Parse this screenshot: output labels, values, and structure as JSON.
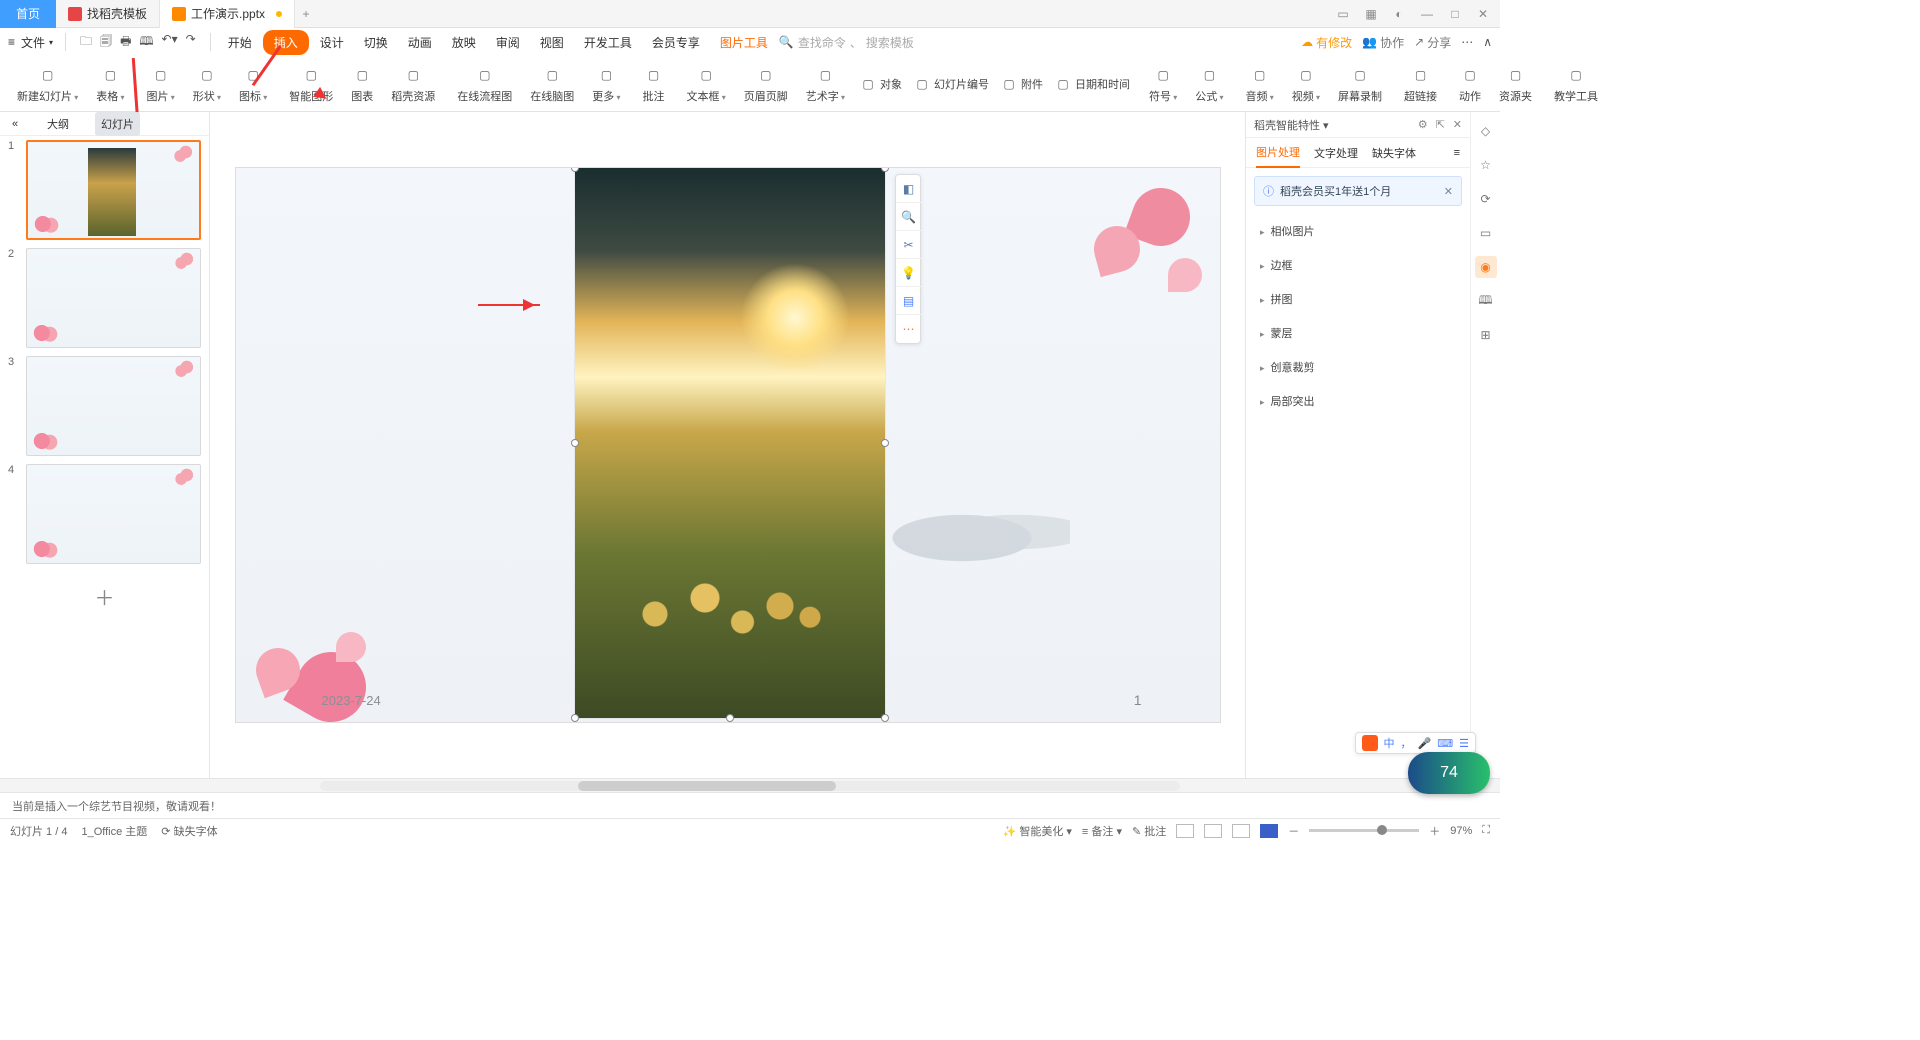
{
  "titlebar": {
    "home": "首页",
    "tab1": "找稻壳模板",
    "tab2": "工作演示.pptx",
    "plus": "+"
  },
  "menubar": {
    "file": "文件",
    "tabs": [
      "开始",
      "插入",
      "设计",
      "切换",
      "动画",
      "放映",
      "审阅",
      "视图",
      "开发工具",
      "会员专享",
      "图片工具"
    ],
    "search_icon_label": "查找命令",
    "search_placeholder": "搜索模板",
    "mod": "有修改",
    "coop": "协作",
    "share": "分享"
  },
  "ribbon": [
    {
      "l": "新建幻灯片",
      "dd": 1
    },
    {
      "l": "表格",
      "dd": 1
    },
    {
      "sep": 1
    },
    {
      "l": "图片",
      "dd": 1
    },
    {
      "l": "形状",
      "dd": 1
    },
    {
      "l": "图标",
      "dd": 1
    },
    {
      "sep": 1
    },
    {
      "l": "智能图形"
    },
    {
      "l": "图表"
    },
    {
      "l": "稻壳资源"
    },
    {
      "sep": 1
    },
    {
      "l": "在线流程图"
    },
    {
      "l": "在线脑图"
    },
    {
      "l": "更多",
      "dd": 1
    },
    {
      "sep": 1
    },
    {
      "l": "批注"
    },
    {
      "sep": 1
    },
    {
      "l": "文本框",
      "dd": 1
    },
    {
      "l": "页眉页脚"
    },
    {
      "l": "艺术字",
      "dd": 1
    },
    {
      "l": "对象",
      "s": 1
    },
    {
      "l": "幻灯片编号",
      "s": 1
    },
    {
      "l": "附件",
      "s": 1
    },
    {
      "l": "日期和时间",
      "s": 1
    },
    {
      "sep": 1
    },
    {
      "l": "符号",
      "dd": 1
    },
    {
      "l": "公式",
      "dd": 1
    },
    {
      "sep": 1
    },
    {
      "l": "音频",
      "dd": 1
    },
    {
      "l": "视频",
      "dd": 1
    },
    {
      "l": "屏幕录制"
    },
    {
      "sep": 1
    },
    {
      "l": "超链接"
    },
    {
      "sep": 1
    },
    {
      "l": "动作"
    },
    {
      "l": "资源夹"
    },
    {
      "sep": 1
    },
    {
      "l": "教学工具"
    }
  ],
  "outline": {
    "tab1": "大纲",
    "tab2": "幻灯片"
  },
  "thumbs": [
    "1",
    "2",
    "3",
    "4"
  ],
  "slide": {
    "date": "2023-7-24",
    "page": "1"
  },
  "rpanel": {
    "title": "稻壳智能特性",
    "tabs": [
      "图片处理",
      "文字处理",
      "缺失字体"
    ],
    "notice": "稻壳会员买1年送1个月",
    "items": [
      "相似图片",
      "边框",
      "拼图",
      "蒙层",
      "创意裁剪",
      "局部突出"
    ]
  },
  "tip": "当前是插入一个综艺节目视频，敬请观看！",
  "status": {
    "left": "幻灯片 1 / 4",
    "theme": "1_Office 主题",
    "missing": "缺失字体",
    "smart": "智能美化",
    "note": "备注",
    "comment": "批注",
    "zoom": "97%"
  },
  "ime": {
    "a": "中",
    "b": "，",
    "c": "🎤",
    "d": "⌨",
    "e": "☰"
  },
  "netwid": "74"
}
